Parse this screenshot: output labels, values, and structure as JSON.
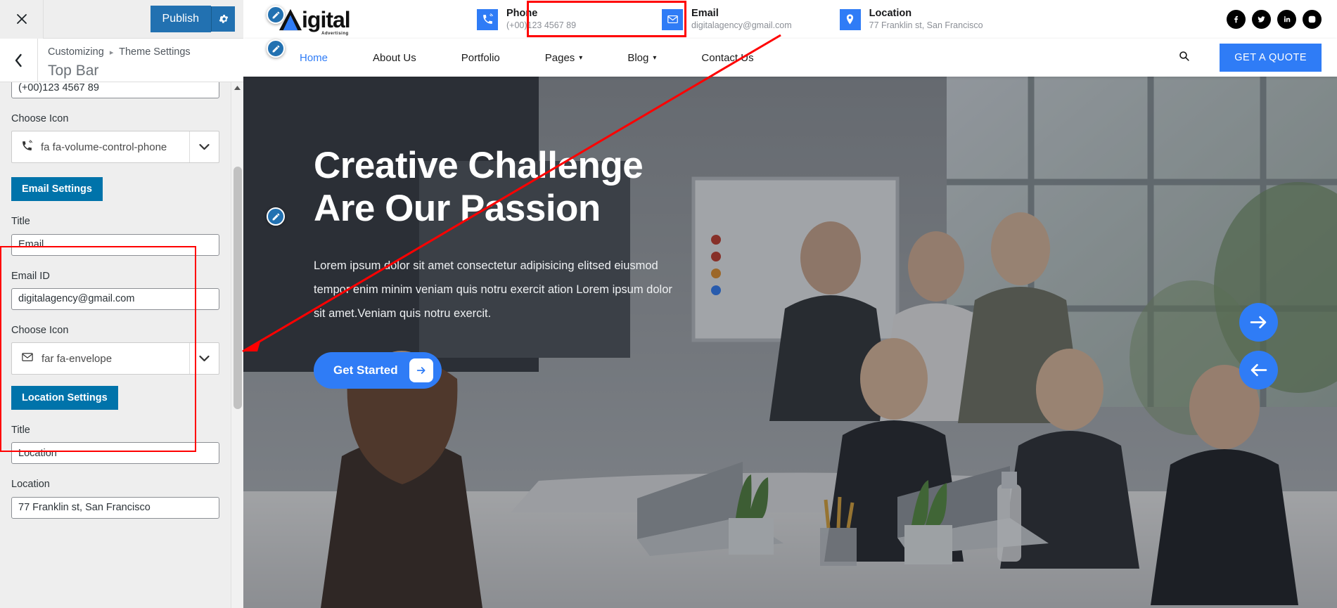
{
  "customizer": {
    "close_icon": "close-icon",
    "publish_label": "Publish",
    "gear_icon": "gear-icon",
    "back_icon": "chevron-left-icon",
    "breadcrumb_root": "Customizing",
    "breadcrumb_sep": "▸",
    "breadcrumb_parent": "Theme Settings",
    "panel_title": "Top Bar",
    "phone_value": "(+00)123 4567 89",
    "phone_icon_label": "Choose Icon",
    "phone_icon_value": "fa fa-volume-control-phone",
    "phone_icon_glyph": "phone-volume-icon",
    "email_section_button": "Email Settings",
    "email_title_label": "Title",
    "email_title_value": "Email",
    "email_id_label": "Email ID",
    "email_id_value": "digitalagency@gmail.com",
    "email_icon_label": "Choose Icon",
    "email_icon_value": "far fa-envelope",
    "email_icon_glyph": "envelope-icon",
    "location_section_button": "Location Settings",
    "location_title_label": "Title",
    "location_title_value": "Location",
    "location_label": "Location",
    "location_value": "77 Franklin st, San Francisco",
    "highlight_color": "#ff0000",
    "accent_color": "#2271b1",
    "section_button_color": "#0073aa"
  },
  "site": {
    "logo_text": "igital",
    "logo_sub": "Advertising",
    "topbar": {
      "phone": {
        "icon": "phone-volume-icon",
        "title": "Phone",
        "value": "(+00)123 4567 89"
      },
      "email": {
        "icon": "envelope-icon",
        "title": "Email",
        "value": "digitalagency@gmail.com"
      },
      "location": {
        "icon": "map-marker-icon",
        "title": "Location",
        "value": "77 Franklin st, San Francisco"
      },
      "social": [
        {
          "name": "facebook-icon",
          "label": "Facebook"
        },
        {
          "name": "twitter-icon",
          "label": "Twitter"
        },
        {
          "name": "linkedin-icon",
          "label": "LinkedIn"
        },
        {
          "name": "instagram-icon",
          "label": "Instagram"
        }
      ]
    },
    "nav": {
      "items": [
        {
          "label": "Home",
          "active": true,
          "caret": ""
        },
        {
          "label": "About Us",
          "active": false,
          "caret": ""
        },
        {
          "label": "Portfolio",
          "active": false,
          "caret": ""
        },
        {
          "label": "Pages",
          "active": false,
          "caret": "⌄"
        },
        {
          "label": "Blog",
          "active": false,
          "caret": "⌄"
        },
        {
          "label": "Contact Us",
          "active": false,
          "caret": ""
        }
      ],
      "search_icon": "search-icon",
      "quote_label": "GET A QUOTE",
      "accent_color": "#2f7cf6"
    },
    "hero": {
      "title_line1": "Creative Challenge",
      "title_line2": "Are Our Passion",
      "paragraph": "Lorem ipsum dolor sit amet consectetur adipisicing elitsed eiusmod tempor enim minim veniam quis notru exercit ation Lorem ipsum dolor sit amet.Veniam quis notru exercit.",
      "cta_label": "Get Started",
      "cta_icon": "arrow-right-icon",
      "next_icon": "arrow-right-icon",
      "prev_icon": "arrow-left-icon"
    }
  }
}
